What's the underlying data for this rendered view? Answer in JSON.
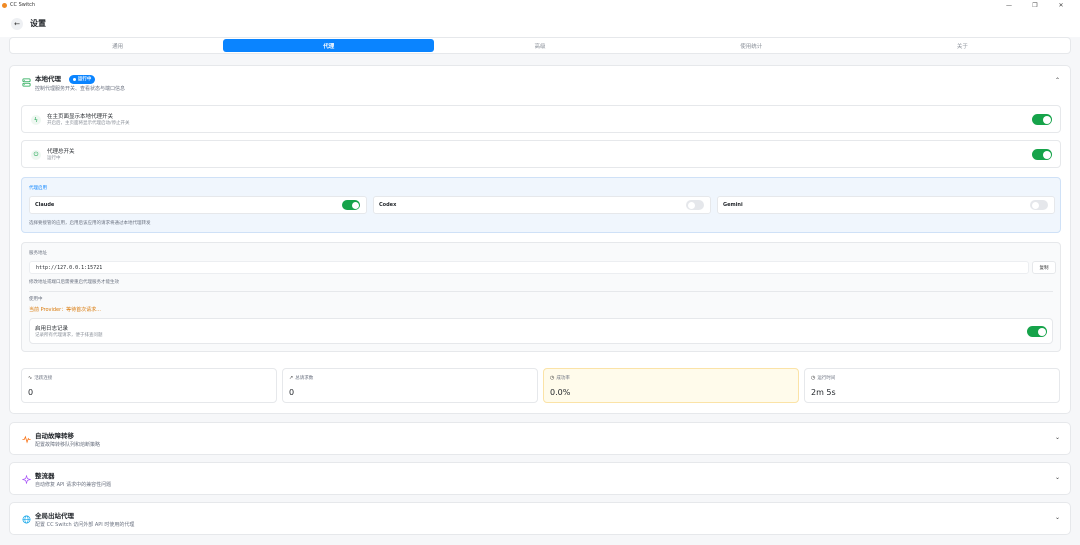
{
  "window": {
    "title": "CC Switch",
    "controls": [
      "—",
      "❐",
      "✕"
    ]
  },
  "header": {
    "title": "设置"
  },
  "tabs": [
    {
      "label": "通用",
      "active": false
    },
    {
      "label": "代理",
      "active": true
    },
    {
      "label": "高级",
      "active": false
    },
    {
      "label": "使用统计",
      "active": false
    },
    {
      "label": "关于",
      "active": false
    }
  ],
  "local_proxy": {
    "title": "本地代理",
    "subtitle": "控制代理服务开关、查看状态与端口信息",
    "badge": "运行中",
    "show_switch": {
      "title": "在主页面显示本地代理开关",
      "subtitle": "开启后，主页面将显示代理启动/停止开关",
      "enabled": true
    },
    "master_switch": {
      "title": "代理总开关",
      "subtitle": "运行中",
      "enabled": true
    },
    "apps": {
      "title": "代理启用",
      "items": [
        {
          "name": "Claude",
          "enabled": true
        },
        {
          "name": "Codex",
          "enabled": false
        },
        {
          "name": "Gemini",
          "enabled": false
        }
      ],
      "note": "选择要接管的应用，启用后该应用的请求将通过本地代理转发"
    },
    "server": {
      "label": "服务地址",
      "address": "http://127.0.0.1:15721",
      "copy_label": "复制",
      "hint": "修改地址或端口后需要重启代理服务才能生效",
      "using_label": "使用中",
      "provider_text": "当前 Provider：等待首次请求...",
      "log": {
        "title": "启用日志记录",
        "subtitle": "记录所有代理请求，便于排查问题",
        "enabled": true
      }
    },
    "stats": [
      {
        "label": "活跃连接",
        "value": "0",
        "icon": "activity-icon"
      },
      {
        "label": "总请求数",
        "value": "0",
        "icon": "trending-icon"
      },
      {
        "label": "成功率",
        "value": "0.0%",
        "icon": "clock-icon"
      },
      {
        "label": "运行时间",
        "value": "2m 5s",
        "icon": "clock-icon"
      }
    ]
  },
  "failover": {
    "title": "自动故障转移",
    "subtitle": "配置故障转移队列和熔断策略"
  },
  "rectifier": {
    "title": "整流器",
    "subtitle": "自动修复 API 请求中的兼容性问题"
  },
  "global_proxy": {
    "title": "全局出站代理",
    "subtitle": "配置 CC Switch 访问外部 API 时使用的代理"
  },
  "colors": {
    "accent": "#0a84ff",
    "toggle_on": "#16a34a",
    "provider": "#d97706"
  }
}
